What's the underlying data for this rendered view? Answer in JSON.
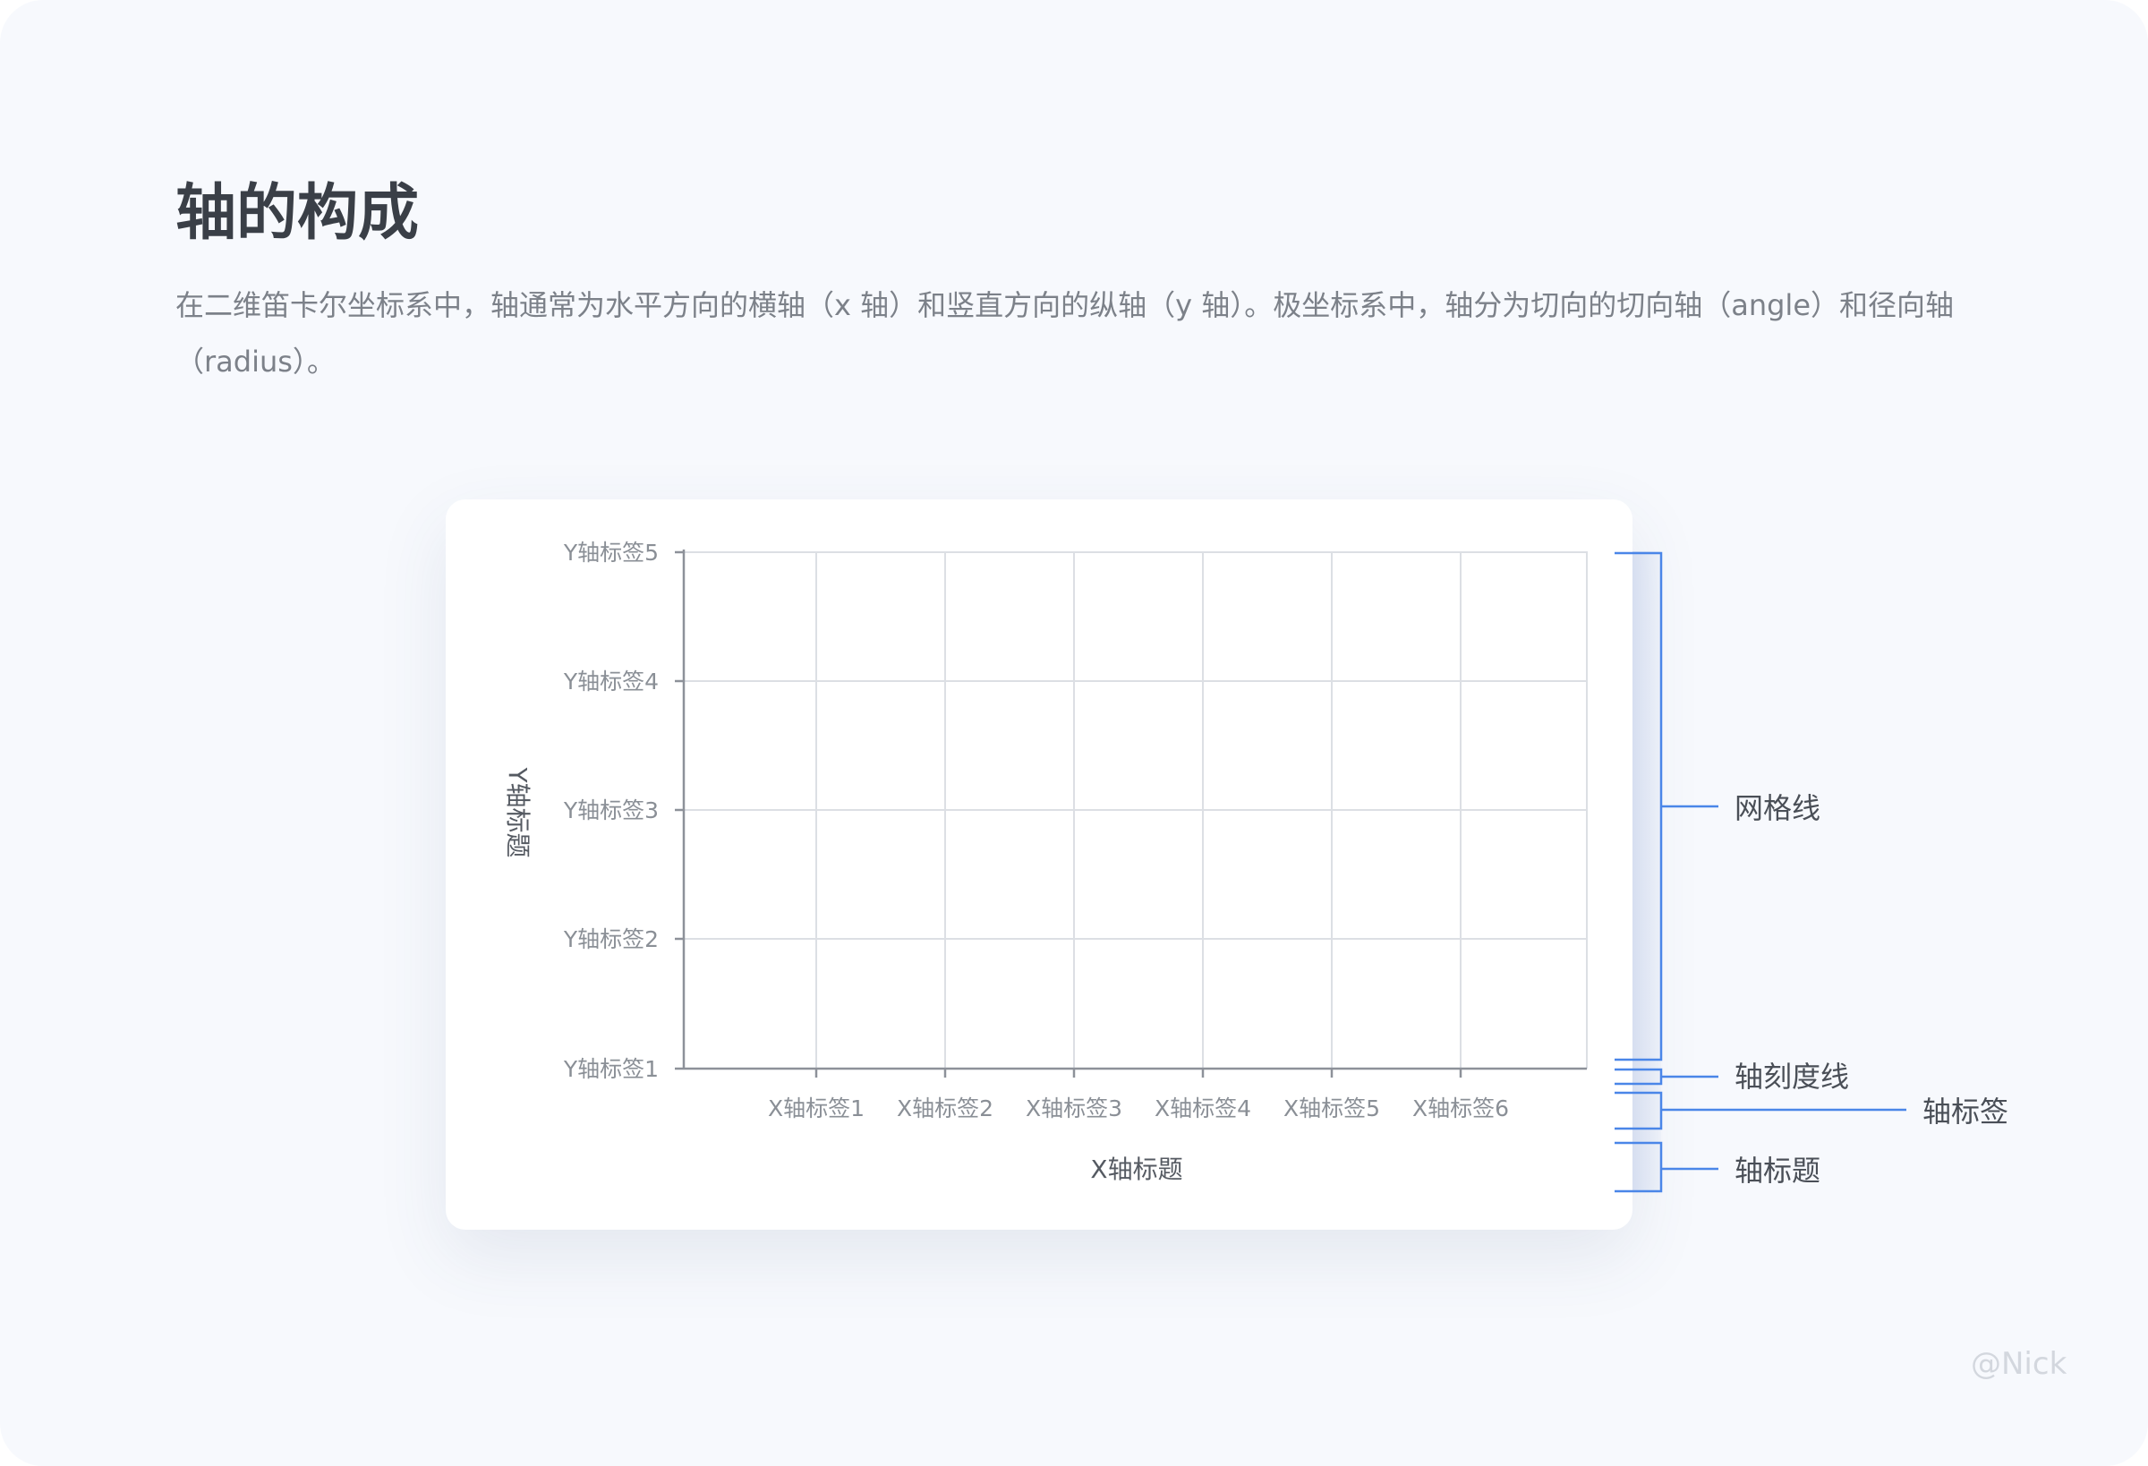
{
  "title": "轴的构成",
  "description": "在二维笛卡尔坐标系中，轴通常为水平方向的横轴（x 轴）和竖直方向的纵轴（y 轴）。极坐标系中，轴分为切向的切向轴（angle）和径向轴（radius）。",
  "chart": {
    "x_ticks": [
      "X轴标签1",
      "X轴标签2",
      "X轴标签3",
      "X轴标签4",
      "X轴标签5",
      "X轴标签6"
    ],
    "y_ticks": [
      "Y轴标签1",
      "Y轴标签2",
      "Y轴标签3",
      "Y轴标签4",
      "Y轴标签5"
    ],
    "x_title": "X轴标题",
    "y_title": "Y轴标题"
  },
  "annotations": {
    "grid": "网格线",
    "tick_line": "轴刻度线",
    "tick_label": "轴标签",
    "axis_title": "轴标题"
  },
  "colors": {
    "grid": "#dcdfe4",
    "axis": "#8d9199",
    "bracket": "#4a86e8"
  },
  "watermark": "@Nick"
}
